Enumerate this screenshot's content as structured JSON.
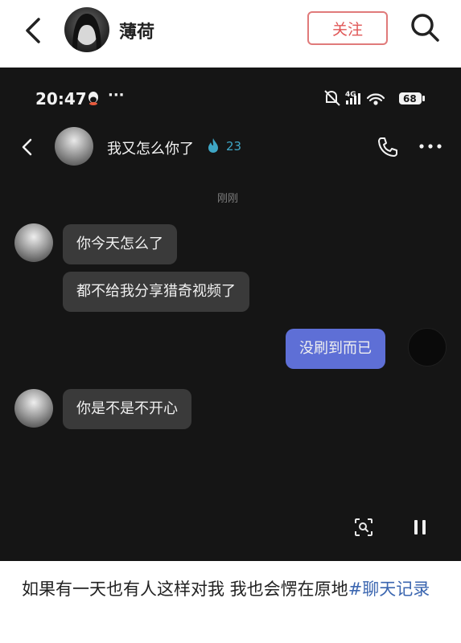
{
  "header": {
    "username": "薄荷",
    "follow_label": "关注"
  },
  "screenshot": {
    "status_bar": {
      "time": "20:47",
      "dots": "···",
      "network": "4G",
      "battery": "68"
    },
    "chat": {
      "title": "我又怎么你了",
      "flame_count": "23",
      "timestamp": "刚刚",
      "messages": [
        {
          "side": "other",
          "text": "你今天怎么了"
        },
        {
          "side": "other",
          "text": "都不给我分享猎奇视频了"
        },
        {
          "side": "self",
          "text": "没刷到而已"
        },
        {
          "side": "other",
          "text": "你是不是不开心"
        }
      ]
    }
  },
  "post": {
    "caption": "如果有一天也有人这样对我 我也会愣在原地",
    "hashtag": "#聊天记录"
  },
  "colors": {
    "follow_border": "#e07a7a",
    "self_bubble": "#5e6fd6",
    "other_bubble": "#3a3a3a",
    "flame": "#3ea6c5",
    "hashtag": "#3b66b0"
  }
}
